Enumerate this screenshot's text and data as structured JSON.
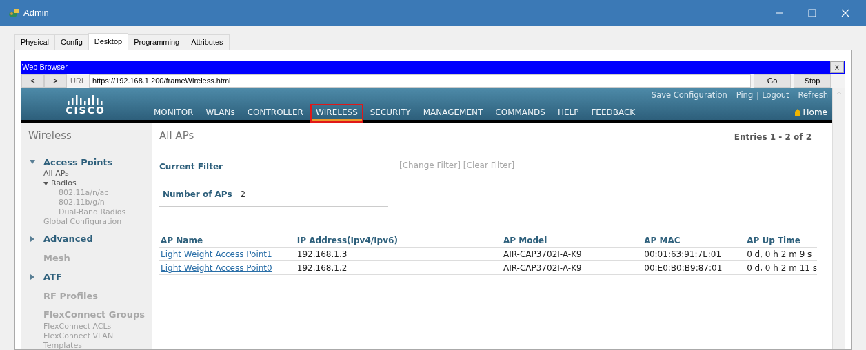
{
  "window": {
    "title": "Admin"
  },
  "tabs": [
    {
      "label": "Physical",
      "selected": false
    },
    {
      "label": "Config",
      "selected": false
    },
    {
      "label": "Desktop",
      "selected": true
    },
    {
      "label": "Programming",
      "selected": false
    },
    {
      "label": "Attributes",
      "selected": false
    }
  ],
  "browser": {
    "title": "Web Browser",
    "close": "X",
    "back": "<",
    "forward": ">",
    "url_label": "URL",
    "url": "https://192.168.1.200/frameWireless.html",
    "go": "Go",
    "stop": "Stop"
  },
  "header": {
    "logo_text": "CISCO",
    "top_links": [
      "Save Configuration",
      "Ping",
      "Logout",
      "Refresh"
    ],
    "menu": [
      {
        "label": "MONITOR",
        "selected": false
      },
      {
        "label": "WLANs",
        "selected": false
      },
      {
        "label": "CONTROLLER",
        "selected": false
      },
      {
        "label": "WIRELESS",
        "selected": true
      },
      {
        "label": "SECURITY",
        "selected": false
      },
      {
        "label": "MANAGEMENT",
        "selected": false
      },
      {
        "label": "COMMANDS",
        "selected": false
      },
      {
        "label": "HELP",
        "selected": false
      },
      {
        "label": "FEEDBACK",
        "selected": false
      }
    ],
    "home": "Home"
  },
  "sidebar": {
    "title": "Wireless",
    "items": [
      {
        "kind": "group",
        "label": "Access Points",
        "expanded": true,
        "disabled": false,
        "children": [
          {
            "label": "All APs",
            "disabled": false
          },
          {
            "label": "Radios",
            "expanded": true,
            "disabled": false,
            "children": [
              {
                "label": "802.11a/n/ac",
                "disabled": true
              },
              {
                "label": "802.11b/g/n",
                "disabled": true
              },
              {
                "label": "Dual-Band Radios",
                "disabled": true
              }
            ]
          },
          {
            "label": "Global Configuration",
            "disabled": true
          }
        ]
      },
      {
        "kind": "group",
        "label": "Advanced",
        "expanded": false,
        "disabled": false
      },
      {
        "kind": "heading",
        "label": "Mesh",
        "disabled": true
      },
      {
        "kind": "group",
        "label": "ATF",
        "expanded": false,
        "disabled": false
      },
      {
        "kind": "heading",
        "label": "RF Profiles",
        "disabled": true
      },
      {
        "kind": "heading",
        "label": "FlexConnect Groups",
        "disabled": true,
        "children": [
          {
            "label": "FlexConnect ACLs",
            "disabled": true
          },
          {
            "label": "FlexConnect VLAN Templates",
            "disabled": true
          }
        ]
      }
    ]
  },
  "main": {
    "title": "All APs",
    "entries": "Entries 1 - 2 of 2",
    "filter_label": "Current Filter",
    "filter_links": [
      "[Change Filter]",
      "[Clear Filter]"
    ],
    "count_label": "Number of APs",
    "count": "2",
    "table": {
      "columns": [
        "AP Name",
        "IP Address(Ipv4/Ipv6)",
        "AP Model",
        "AP MAC",
        "AP Up Time"
      ],
      "rows": [
        [
          "Light Weight Access Point1",
          "192.168.1.3",
          "AIR-CAP3702I-A-K9",
          "00:01:63:91:7E:01",
          "0 d, 0 h 2 m 9 s"
        ],
        [
          "Light Weight Access Point0",
          "192.168.1.2",
          "AIR-CAP3702I-A-K9",
          "00:E0:B0:B9:87:01",
          "0 d, 0 h 2 m 11 s"
        ]
      ]
    }
  }
}
